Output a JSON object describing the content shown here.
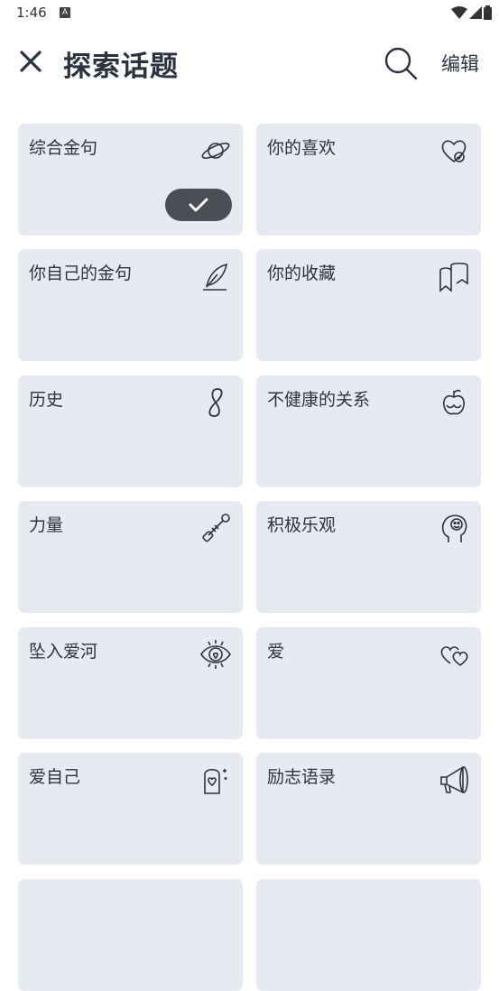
{
  "status": {
    "time": "1:46",
    "notif": "A"
  },
  "header": {
    "title": "探索话题",
    "edit": "编辑"
  },
  "topics": [
    {
      "label": "综合金句",
      "icon": "planet-icon",
      "selected": true
    },
    {
      "label": "你的喜欢",
      "icon": "heart-check-icon"
    },
    {
      "label": "你自己的金句",
      "icon": "feather-icon"
    },
    {
      "label": "你的收藏",
      "icon": "bookmark-icon"
    },
    {
      "label": "历史",
      "icon": "infinity-icon"
    },
    {
      "label": "不健康的关系",
      "icon": "rotten-apple-icon"
    },
    {
      "label": "力量",
      "icon": "dumbbell-icon"
    },
    {
      "label": "积极乐观",
      "icon": "smiling-head-icon"
    },
    {
      "label": "坠入爱河",
      "icon": "eye-heart-icon"
    },
    {
      "label": "爱",
      "icon": "two-hearts-icon"
    },
    {
      "label": "爱自己",
      "icon": "mirror-heart-icon"
    },
    {
      "label": "励志语录",
      "icon": "megaphone-icon"
    }
  ]
}
